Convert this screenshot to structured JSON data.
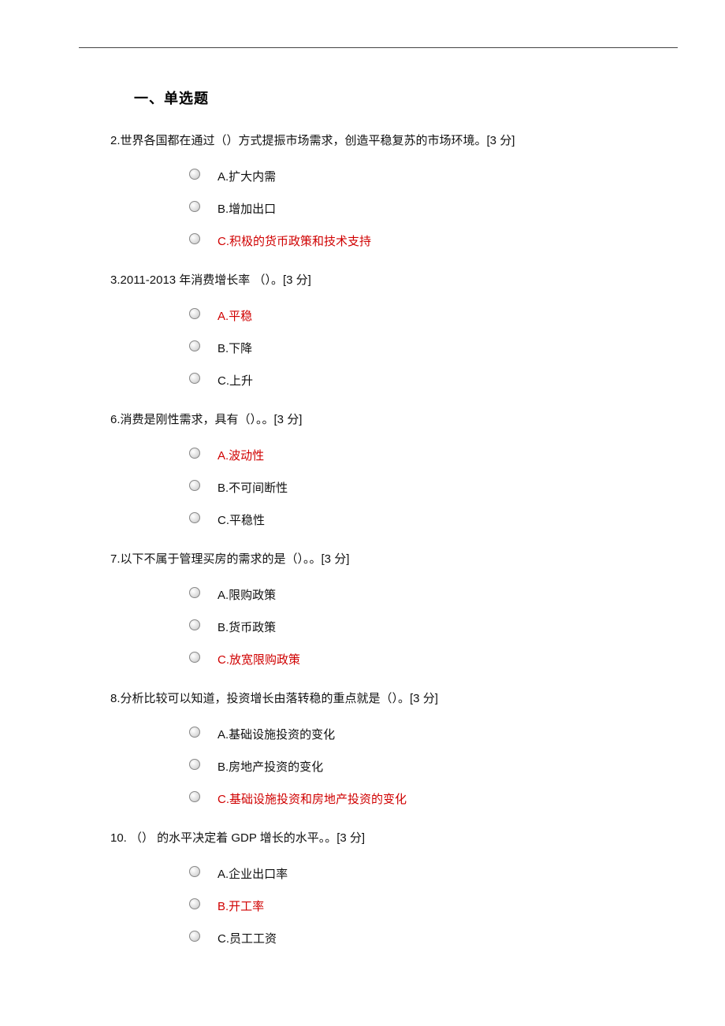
{
  "section_title": "一、单选题",
  "questions": [
    {
      "num": "2",
      "text": "2.世界各国都在通过（）方式提振市场需求，创造平稳复苏的市场环境。[3 分]",
      "options": [
        {
          "label": "A.扩大内需",
          "answer": false
        },
        {
          "label": "B.增加出口",
          "answer": false
        },
        {
          "label": "C.积极的货币政策和技术支持",
          "answer": true
        }
      ]
    },
    {
      "num": "3",
      "text": "3.2011-2013 年消费增长率 （）。[3 分]",
      "options": [
        {
          "label": "A.平稳",
          "answer": true
        },
        {
          "label": "B.下降",
          "answer": false
        },
        {
          "label": "C.上升",
          "answer": false
        }
      ]
    },
    {
      "num": "6",
      "text": "6.消费是刚性需求，具有（）。。[3 分]",
      "options": [
        {
          "label": "A.波动性",
          "answer": true
        },
        {
          "label": "B.不可间断性",
          "answer": false
        },
        {
          "label": "C.平稳性",
          "answer": false
        }
      ]
    },
    {
      "num": "7",
      "text": "7.以下不属于管理买房的需求的是（）。。[3 分]",
      "options": [
        {
          "label": "A.限购政策",
          "answer": false
        },
        {
          "label": "B.货币政策",
          "answer": false
        },
        {
          "label": "C.放宽限购政策",
          "answer": true
        }
      ]
    },
    {
      "num": "8",
      "text": "8.分析比较可以知道，投资增长由落转稳的重点就是（）。[3 分]",
      "options": [
        {
          "label": "A.基础设施投资的变化",
          "answer": false
        },
        {
          "label": "B.房地产投资的变化",
          "answer": false
        },
        {
          "label": "C.基础设施投资和房地产投资的变化",
          "answer": true
        }
      ]
    },
    {
      "num": "10",
      "text": "10. （） 的水平决定着 GDP 增长的水平。。[3 分]",
      "options": [
        {
          "label": "A.企业出口率",
          "answer": false
        },
        {
          "label": "B.开工率",
          "answer": true
        },
        {
          "label": "C.员工工资",
          "answer": false
        }
      ]
    }
  ]
}
